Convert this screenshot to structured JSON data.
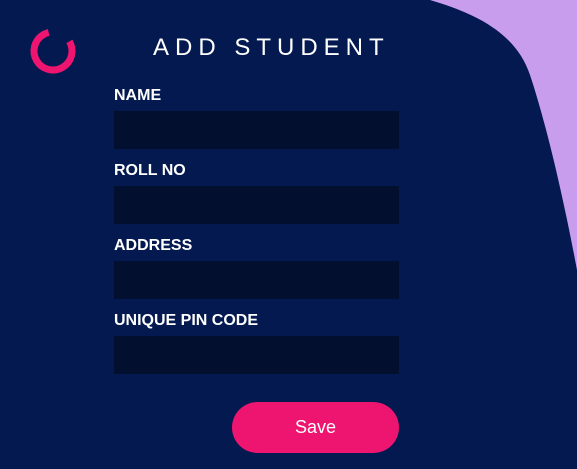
{
  "header": {
    "title": "ADD STUDENT",
    "logo_icon": "spinner-ring-icon"
  },
  "form": {
    "fields": [
      {
        "label": "NAME",
        "value": ""
      },
      {
        "label": "ROLL NO",
        "value": ""
      },
      {
        "label": "ADDRESS",
        "value": ""
      },
      {
        "label": "UNIQUE PIN CODE",
        "value": ""
      }
    ],
    "save_label": "Save"
  },
  "colors": {
    "background": "#03194f",
    "accent_blob": "#c99dee",
    "input_background": "#020f2e",
    "button": "#ee1570",
    "logo": "#ee1570",
    "text": "#ffffff"
  }
}
